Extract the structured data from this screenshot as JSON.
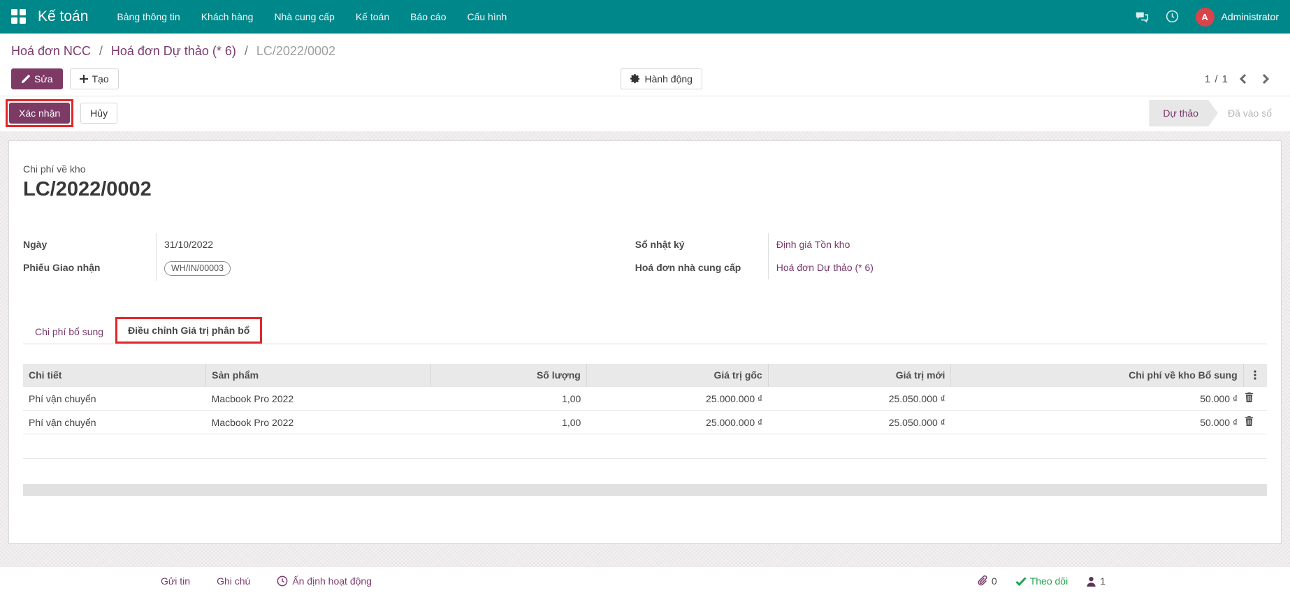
{
  "topbar": {
    "app": "Kế toán",
    "menus": [
      "Bảng thông tin",
      "Khách hàng",
      "Nhà cung cấp",
      "Kế toán",
      "Báo cáo",
      "Cấu hình"
    ],
    "avatar_initial": "A",
    "user": "Administrator"
  },
  "breadcrumb": {
    "items": [
      "Hoá đơn NCC",
      "Hoá đơn Dự thảo (* 6)",
      "LC/2022/0002"
    ],
    "separator": "/"
  },
  "controls": {
    "edit": "Sửa",
    "create": "Tạo",
    "action": "Hành động",
    "pager": "1 / 1"
  },
  "statusbar": {
    "confirm": "Xác nhận",
    "cancel": "Hủy",
    "states": [
      "Dự thảo",
      "Đã vào sổ"
    ],
    "active_state": "Dự thảo"
  },
  "sheet": {
    "subtitle": "Chi phí về kho",
    "title": "LC/2022/0002",
    "left_fields": [
      {
        "label": "Ngày",
        "value": "31/10/2022",
        "kind": "text"
      },
      {
        "label": "Phiếu Giao nhận",
        "value": "WH/IN/00003",
        "kind": "badge"
      }
    ],
    "right_fields": [
      {
        "label": "Sổ nhật ký",
        "value": "Định giá Tồn kho",
        "kind": "link"
      },
      {
        "label": "Hoá đơn nhà cung cấp",
        "value": "Hoá đơn Dự thảo (* 6)",
        "kind": "link"
      }
    ],
    "tabs": [
      "Chi phí bổ sung",
      "Điều chỉnh Giá trị phân bổ"
    ],
    "active_tab": "Điều chỉnh Giá trị phân bổ"
  },
  "table": {
    "headers": [
      "Chi tiết",
      "Sản phẩm",
      "Số lượng",
      "Giá trị gốc",
      "Giá trị mới",
      "Chi phí về kho Bổ sung"
    ],
    "rows": [
      [
        "Phí vận chuyển",
        "Macbook Pro 2022",
        "1,00",
        "25.000.000 ₫",
        "25.050.000 ₫",
        "50.000 ₫"
      ],
      [
        "Phí vận chuyển",
        "Macbook Pro 2022",
        "1,00",
        "25.000.000 ₫",
        "25.050.000 ₫",
        "50.000 ₫"
      ]
    ]
  },
  "chatter": {
    "send_message": "Gửi tin",
    "log_note": "Ghi chú",
    "schedule_activity": "Ấn định hoạt động",
    "attachment_count": "0",
    "follow": "Theo dõi",
    "follower_count": "1"
  },
  "colors": {
    "topbar": "#00878a",
    "accent": "#7a3a6d",
    "annotation_red": "#e3262a",
    "avatar_red": "#d9444a",
    "follow_green": "#21a350"
  }
}
